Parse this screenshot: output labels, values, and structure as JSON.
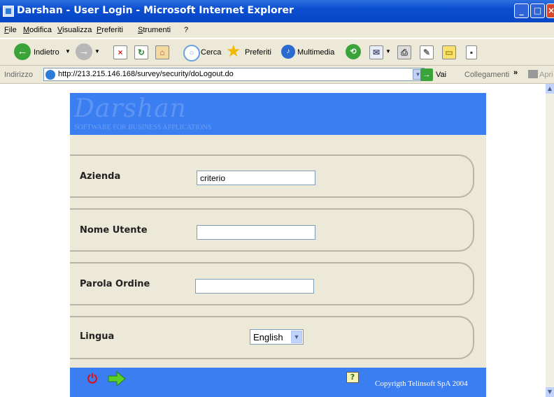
{
  "window": {
    "title": "Darshan - User Login - Microsoft Internet Explorer"
  },
  "menu": [
    "File",
    "Modifica",
    "Visualizza",
    "Preferiti",
    "Strumenti",
    "?"
  ],
  "toolbar": {
    "back": "Indietro",
    "search": "Cerca",
    "favorites": "Preferiti",
    "multimedia": "Multimedia"
  },
  "address": {
    "label": "Indirizzo",
    "url": "http://213.215.146.168/survey/security/doLogout.do",
    "go": "Vai",
    "links": "Collegamenti",
    "chevron": "»",
    "apri": "Apri"
  },
  "brand": {
    "name": "Darshan",
    "tagline": "SOFTWARE FOR BUSINESS APPLICATIONS"
  },
  "form": {
    "azienda_label": "Azienda",
    "azienda_value": "criterio",
    "user_label": "Nome Utente",
    "user_value": "",
    "password_label": "Parola Ordine",
    "password_value": "",
    "lingua_label": "Lingua",
    "lingua_value": "English"
  },
  "footer": {
    "copyright": "Copyrigth Telinsoft SpA 2004",
    "help": "?"
  },
  "colors": {
    "banner": "#3b7ef2",
    "page_bg": "#ece9d8",
    "titlebar": "#0a4ed0"
  }
}
